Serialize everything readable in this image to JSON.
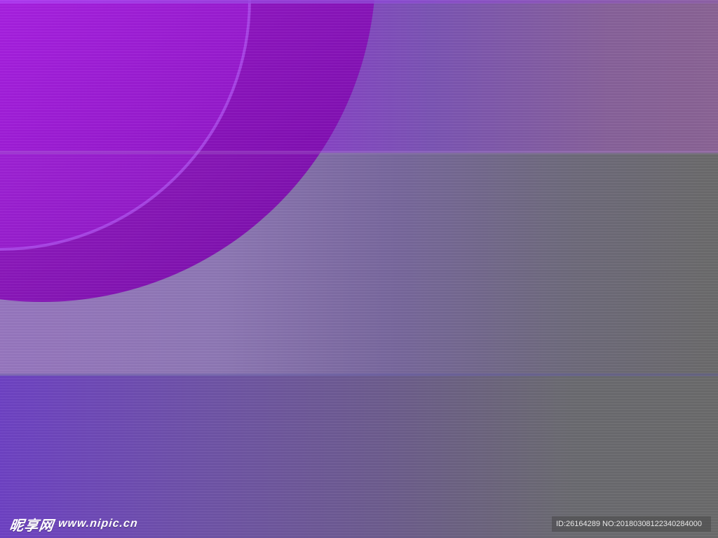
{
  "watermark": {
    "site_name": "昵享网",
    "url": "www.nipic.cn",
    "id_text": "ID:26164289 NO:20180308122340284000"
  },
  "colors": {
    "purple": "#a51fe0",
    "dark_purple": "#7b10b8",
    "gray": "#6b6b6b",
    "lavender": "#9777bf"
  }
}
